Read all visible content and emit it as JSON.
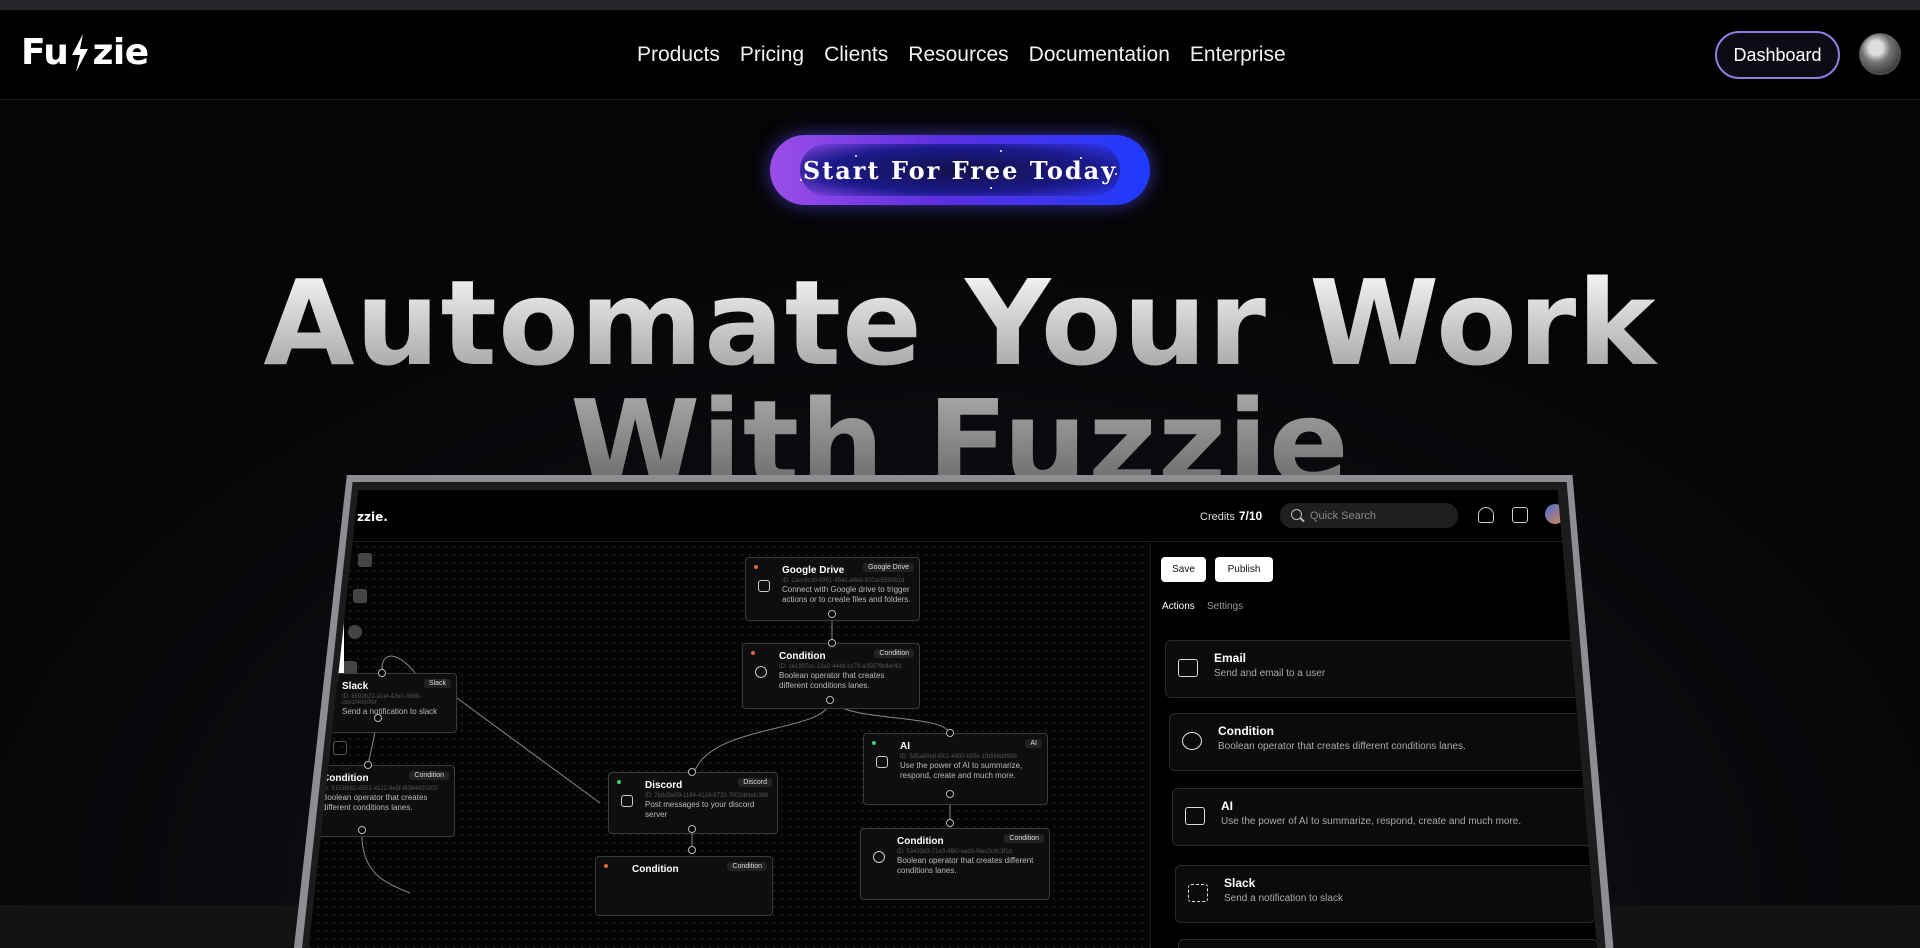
{
  "nav": {
    "logo_left": "Fu",
    "logo_right": "zie",
    "menu": [
      "Products",
      "Pricing",
      "Clients",
      "Resources",
      "Documentation",
      "Enterprise"
    ],
    "dashboard_label": "Dashboard"
  },
  "hero": {
    "cta_label": "Start For Free Today",
    "headline_line1": "Automate Your Work",
    "headline_line2": "With Fuzzie"
  },
  "app": {
    "logo": "zzie.",
    "credits_label": "Credits",
    "credits_value": "7/10",
    "search_placeholder": "Quick Search",
    "save_label": "Save",
    "publish_label": "Publish",
    "tabs": [
      "Actions",
      "Settings"
    ],
    "nodes": [
      {
        "title": "Google Drive",
        "tag": "Google Drive",
        "id": "ID: 1acc9c30-0961-454c-a8e8-820ac590081d",
        "desc": "Connect with Google drive to trigger actions or to create files and folders."
      },
      {
        "title": "Condition",
        "tag": "Condition",
        "id": "ID: 1e1997ec-13a0-444d-cc79-a35679b4e061",
        "desc": "Boolean operator that creates different conditions lanes."
      },
      {
        "title": "Slack",
        "tag": "Slack",
        "id": "ID: 8592b22-a1ef-42e0-b988-cbe1f4060fef",
        "desc": "Send a notification to slack"
      },
      {
        "title": "AI",
        "tag": "AI",
        "id": "ID: 5d5a80e8-8fc1-4990-b09c-1fb966d995b",
        "desc": "Use the power of AI to summarize, respond, create and much more."
      },
      {
        "title": "Condition",
        "tag": "Condition",
        "id": "ID: 5153fb82-d551-4122-9e5f-f6364820202",
        "desc": "Boolean operator that creates different conditions lanes."
      },
      {
        "title": "Discord",
        "tag": "Discord",
        "id": "ID: 2b8d3e59-1184-4124-8733-7002d8bdc396",
        "desc": "Post messages to your discord server"
      },
      {
        "title": "Condition",
        "tag": "Condition",
        "id": "ID: 53433d3-71e3-4f80-aad3-f6ec0c8c3f1d",
        "desc": "Boolean operator that creates different conditions lanes."
      },
      {
        "title": "Condition",
        "tag": "Condition",
        "id": "",
        "desc": ""
      }
    ],
    "actions": [
      {
        "title": "Email",
        "desc": "Send and email to a user",
        "icon": "mail-icon"
      },
      {
        "title": "Condition",
        "desc": "Boolean operator that creates different conditions lanes.",
        "icon": "branch-icon"
      },
      {
        "title": "AI",
        "desc": "Use the power of AI to summarize, respond, create and much more.",
        "icon": "ai-icon"
      },
      {
        "title": "Slack",
        "desc": "Send a notification to slack",
        "icon": "slack-icon"
      }
    ]
  },
  "colors": {
    "accent": "#8a7fe0",
    "cta_start": "#9b4ee8",
    "cta_end": "#1f3bff"
  }
}
